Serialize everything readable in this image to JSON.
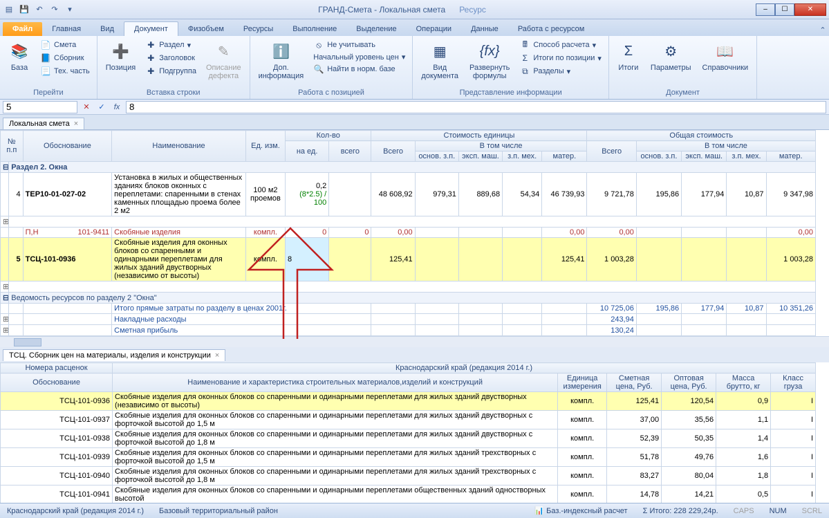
{
  "window": {
    "title": "ГРАНД-Смета - Локальная смета",
    "tool_context": "Ресурс"
  },
  "tabs": {
    "file": "Файл",
    "items": [
      "Главная",
      "Вид",
      "Документ",
      "Физобъем",
      "Ресурсы",
      "Выполнение",
      "Выделение",
      "Операции",
      "Данные",
      "Работа с ресурсом"
    ],
    "active": "Документ"
  },
  "ribbon": {
    "g1": {
      "label": "Перейти",
      "base": "База",
      "smeta": "Смета",
      "sbornik": "Сборник",
      "tech": "Тех. часть"
    },
    "g2": {
      "label": "Вставка строки",
      "pos": "Позиция",
      "razdel": "Раздел",
      "zag": "Заголовок",
      "podg": "Подгруппа",
      "defect": "Описание\nдефекта"
    },
    "g3": {
      "label": "Работа с позицией",
      "dopinfo": "Доп.\nинформация",
      "neuch": "Не учитывать",
      "nachur": "Начальный уровень цен",
      "naiti": "Найти в норм. базе"
    },
    "g4": {
      "label": "Представление информации",
      "viddoc": "Вид\nдокумента",
      "razv": "Развернуть\nформулы",
      "sposob": "Способ расчета",
      "itogipos": "Итоги по позиции",
      "razdely": "Разделы"
    },
    "g5": {
      "label": "Документ",
      "itogi": "Итоги",
      "param": "Параметры",
      "sprav": "Справочники"
    }
  },
  "formula": {
    "name": "5",
    "value": "8"
  },
  "doctab": {
    "label": "Локальная смета"
  },
  "grid": {
    "headers": {
      "npp": "№\nп.п",
      "obosn": "Обоснование",
      "naim": "Наименование",
      "ed": "Ед. изм.",
      "kolvo": "Кол-во",
      "naed": "на ед.",
      "vsego": "всего",
      "stoim_ed": "Стоимость единицы",
      "total": "Всего",
      "vtom": "В том числе",
      "osnzp": "основ. з.п.",
      "eksp": "эксп. маш.",
      "zpmex": "з.п. мех.",
      "mater": "матер.",
      "obsh": "Общая стоимость",
      "vsego2": "Всего"
    },
    "section": "Раздел 2. Окна",
    "row4": {
      "n": "4",
      "obosn": "ТЕР10-01-027-02",
      "naim": "Установка в жилых и общественных зданиях блоков оконных с переплетами: спаренными в стенах каменных площадью проема более 2 м2",
      "ed": "100 м2 проемов",
      "naed": "0,2",
      "naed_f": "(8*2.5) / 100",
      "vsego": "48 608,92",
      "osnzp": "979,31",
      "eksp": "889,68",
      "zpmex": "54,34",
      "mater": "46 739,93",
      "tot": "9 721,78",
      "t_osnzp": "195,86",
      "t_eksp": "177,94",
      "t_zpmex": "10,87",
      "t_mater": "9 347,98"
    },
    "rowlink": {
      "pn": "П,Н",
      "code": "101-9411",
      "naim": "Скобяные изделия",
      "ed": "компл.",
      "naed": "0",
      "vsego": "0",
      "sum": "0,00",
      "mater": "0,00",
      "tot": "0,00",
      "tmater": "0,00"
    },
    "row5": {
      "n": "5",
      "obosn": "ТСЦ-101-0936",
      "naim": "Скобяные изделия для оконных блоков со спаренными и одинарными переплетами для жилых зданий двустворных (независимо от высоты)",
      "ed": "компл.",
      "naed": "8",
      "sum": "125,41",
      "mater": "125,41",
      "tot": "1 003,28",
      "tmater": "1 003,28"
    },
    "vedomost": "Ведомость ресурсов по разделу 2 \"Окна\"",
    "itogo_line": "Итого прямые затраты по разделу в ценах 2001г.",
    "itogo": {
      "tot": "10 725,06",
      "osnzp": "195,86",
      "eksp": "177,94",
      "zpmex": "10,87",
      "mater": "10 351,26"
    },
    "nakl": "Накладные расходы",
    "nakl_v": "243,94",
    "smet": "Сметная прибыль",
    "smet_v": "130,24"
  },
  "lower": {
    "tab": "ТСЦ. Сборник цен на материалы, изделия и конструкции",
    "region": "Краснодарский край (редакция 2014 г.)",
    "headers": {
      "nom": "Номера расценок",
      "obosn": "Обоснование",
      "naim": "Наименование и характеристика строительных материалов,изделий и конструкций",
      "ed": "Единица измерения",
      "smet": "Сметная цена, Руб.",
      "opt": "Оптовая цена, Руб.",
      "massa": "Масса брутто, кг",
      "klass": "Класс груза"
    },
    "rows": [
      {
        "code": "ТСЦ-101-0936",
        "naim": "Скобяные изделия для оконных блоков со спаренными и одинарными переплетами для жилых зданий двустворных (независимо от высоты)",
        "ed": "компл.",
        "smet": "125,41",
        "opt": "120,54",
        "massa": "0,9",
        "klass": "I"
      },
      {
        "code": "ТСЦ-101-0937",
        "naim": "Скобяные изделия для оконных блоков со спаренными и одинарными переплетами для жилых зданий двустворных с форточкой высотой до 1,5 м",
        "ed": "компл.",
        "smet": "37,00",
        "opt": "35,56",
        "massa": "1,1",
        "klass": "I"
      },
      {
        "code": "ТСЦ-101-0938",
        "naim": "Скобяные изделия для оконных блоков со спаренными и одинарными переплетами для жилых зданий двустворных с форточкой высотой до 1,8 м",
        "ed": "компл.",
        "smet": "52,39",
        "opt": "50,35",
        "massa": "1,4",
        "klass": "I"
      },
      {
        "code": "ТСЦ-101-0939",
        "naim": "Скобяные изделия для оконных блоков со спаренными и одинарными переплетами для жилых зданий трехстворных с форточкой высотой до 1,5 м",
        "ed": "компл.",
        "smet": "51,78",
        "opt": "49,76",
        "massa": "1,6",
        "klass": "I"
      },
      {
        "code": "ТСЦ-101-0940",
        "naim": "Скобяные изделия для оконных блоков со спаренными и одинарными переплетами для жилых зданий трехстворных с форточкой высотой до 1,8 м",
        "ed": "компл.",
        "smet": "83,27",
        "opt": "80,04",
        "massa": "1,8",
        "klass": "I"
      },
      {
        "code": "ТСЦ-101-0941",
        "naim": "Скобяные изделия для оконных блоков со спаренными и одинарными переплетами общественных зданий одностворных высотой",
        "ed": "компл.",
        "smet": "14,78",
        "opt": "14,21",
        "massa": "0,5",
        "klass": "I"
      }
    ]
  },
  "status": {
    "left1": "Краснодарский край (редакция 2014 г.)",
    "left2": "Базовый территориальный район",
    "calc": "Баз.-индексный расчет",
    "itogo": "Итого: 228 229,24р.",
    "caps": "CAPS",
    "num": "NUM",
    "scrl": "SCRL"
  }
}
